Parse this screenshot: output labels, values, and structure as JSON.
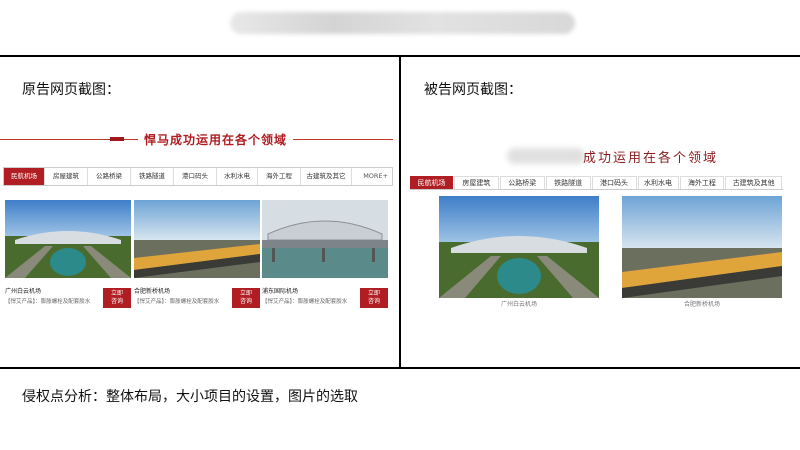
{
  "top_title_blurred": true,
  "left_panel": {
    "label": "原告网页截图：",
    "heading": "悍马成功运用在各个领域",
    "tabs": [
      "民航机场",
      "房屋建筑",
      "公路桥梁",
      "铁路隧道",
      "港口码头",
      "水利水电",
      "海外工程",
      "古建筑及其它"
    ],
    "more": "MORE+",
    "cards": [
      {
        "name": "广州白云机场",
        "desc": "【悍艾产品】：膨胀螺栓及配套胶水",
        "btn": "立即\n咨询"
      },
      {
        "name": "合肥新桥机场",
        "desc": "【悍艾产品】：膨胀螺栓及配套胶水",
        "btn": "立即\n咨询"
      },
      {
        "name": "浦东国际机场",
        "desc": "【悍艾产品】：膨胀螺栓及配套胶水",
        "btn": "立即\n咨询"
      }
    ]
  },
  "right_panel": {
    "label": "被告网页截图：",
    "heading": "成功运用在各个领域",
    "tabs": [
      "民航机场",
      "房屋建筑",
      "公路桥梁",
      "铁路隧道",
      "港口码头",
      "水利水电",
      "海外工程",
      "古建筑及其他"
    ],
    "cards": [
      {
        "caption": "广州白云机场"
      },
      {
        "caption": "合肥新桥机场"
      }
    ]
  },
  "analysis": "侵权点分析：整体布局，大小项目的设置，图片的选取",
  "colors": {
    "accent": "#b01e23",
    "divider": "#000000"
  }
}
